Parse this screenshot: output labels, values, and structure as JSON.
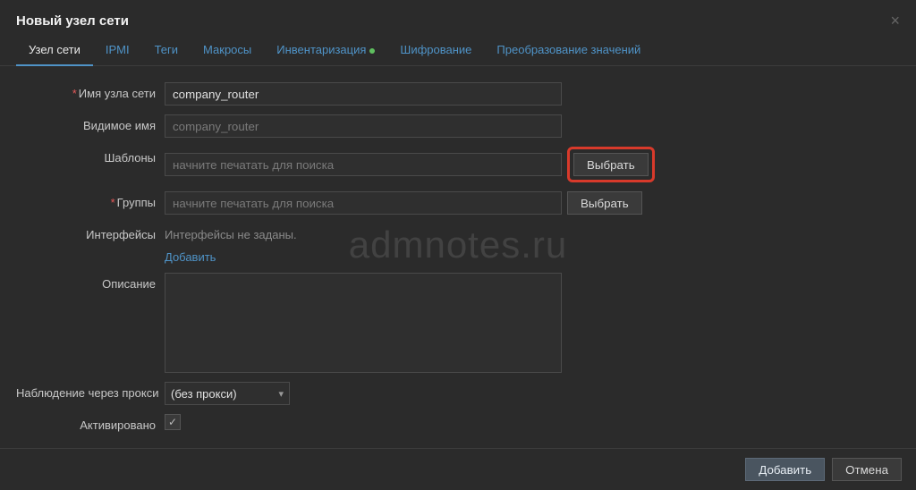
{
  "dialog": {
    "title": "Новый узел сети"
  },
  "tabs": [
    {
      "label": "Узел сети",
      "active": true,
      "indicator": false
    },
    {
      "label": "IPMI",
      "active": false,
      "indicator": false
    },
    {
      "label": "Теги",
      "active": false,
      "indicator": false
    },
    {
      "label": "Макросы",
      "active": false,
      "indicator": false
    },
    {
      "label": "Инвентаризация",
      "active": false,
      "indicator": true
    },
    {
      "label": "Шифрование",
      "active": false,
      "indicator": false
    },
    {
      "label": "Преобразование значений",
      "active": false,
      "indicator": false
    }
  ],
  "labels": {
    "host_name": "Имя узла сети",
    "visible_name": "Видимое имя",
    "templates": "Шаблоны",
    "groups": "Группы",
    "interfaces": "Интерфейсы",
    "description": "Описание",
    "proxy": "Наблюдение через прокси",
    "enabled": "Активировано"
  },
  "values": {
    "host_name": "company_router",
    "visible_name_placeholder": "company_router",
    "search_placeholder": "начните печатать для поиска",
    "interfaces_empty": "Интерфейсы не заданы.",
    "add_link": "Добавить",
    "proxy_selected": "(без прокси)",
    "enabled_checked": true
  },
  "buttons": {
    "select": "Выбрать",
    "add": "Добавить",
    "cancel": "Отмена"
  },
  "watermark": "admnotes.ru"
}
